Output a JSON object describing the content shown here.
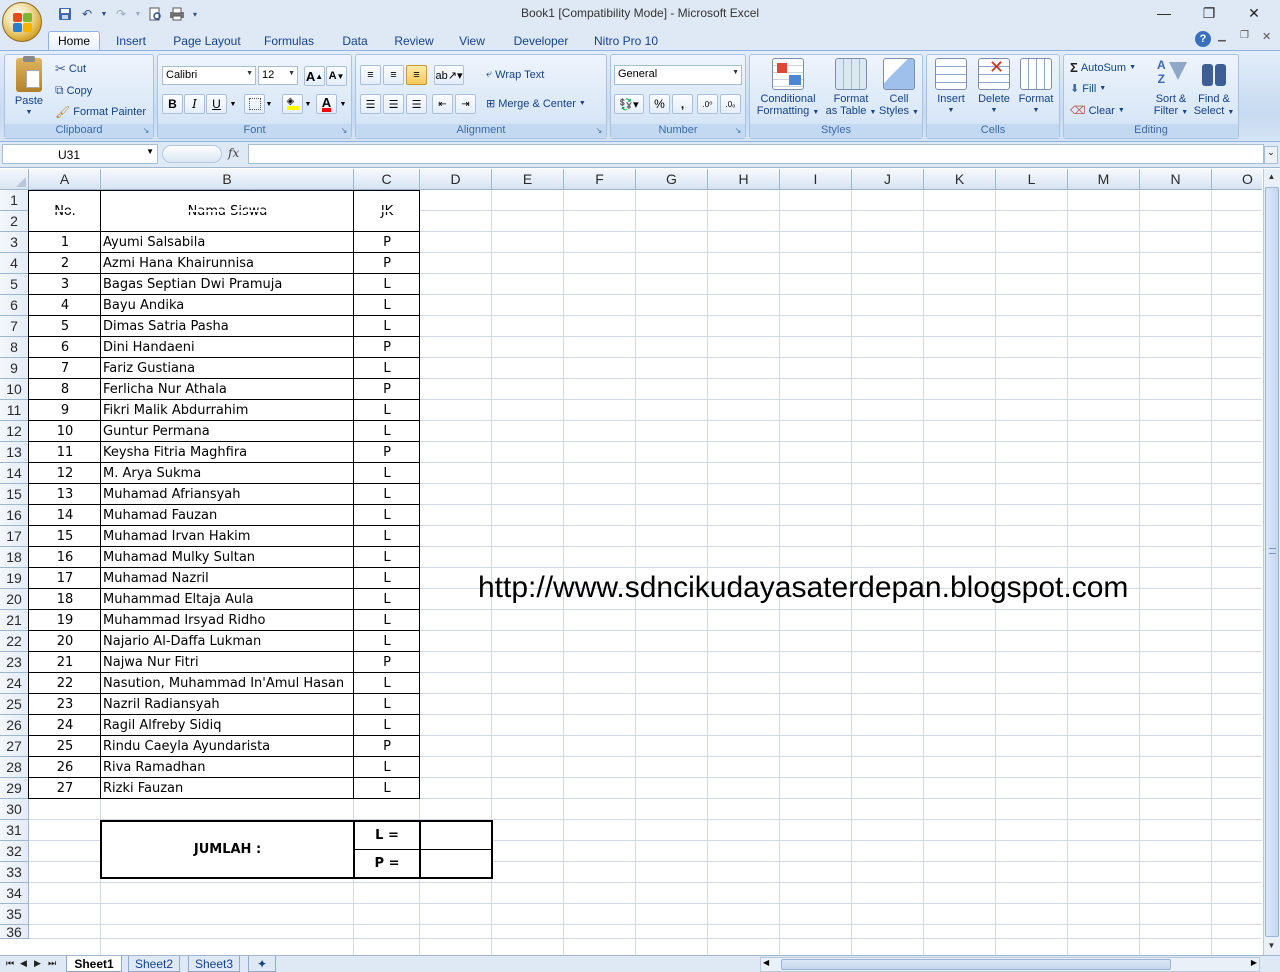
{
  "window": {
    "title": "Book1  [Compatibility Mode] - Microsoft Excel",
    "minimize": "—",
    "restore": "❐",
    "close": "✕"
  },
  "qat": {
    "save_icon": "save-icon",
    "undo_icon": "undo-icon",
    "redo_icon": "redo-icon"
  },
  "tabs": [
    "Home",
    "Insert",
    "Page Layout",
    "Formulas",
    "Data",
    "Review",
    "View",
    "Developer",
    "Nitro Pro 10"
  ],
  "ribbon": {
    "clipboard": {
      "label": "Clipboard",
      "paste": "Paste",
      "cut": "Cut",
      "copy": "Copy",
      "format_painter": "Format Painter"
    },
    "font": {
      "label": "Font",
      "family": "Calibri",
      "size": "12",
      "bold": "B",
      "italic": "I",
      "underline": "U"
    },
    "alignment": {
      "label": "Alignment",
      "wrap_text": "Wrap Text",
      "merge_center": "Merge & Center"
    },
    "number": {
      "label": "Number",
      "format": "General",
      "percent": "%",
      "comma": ",",
      "inc_decimal": ".0→.00",
      "dec_decimal": ".00→.0"
    },
    "styles": {
      "label": "Styles",
      "conditional": [
        "Conditional",
        "Formatting"
      ],
      "format_table": [
        "Format",
        "as Table"
      ],
      "cell_styles": [
        "Cell",
        "Styles"
      ]
    },
    "cells": {
      "label": "Cells",
      "insert": "Insert",
      "delete": "Delete",
      "format": "Format"
    },
    "editing": {
      "label": "Editing",
      "autosum": "AutoSum",
      "fill": "Fill",
      "clear": "Clear",
      "sort_filter": [
        "Sort &",
        "Filter"
      ],
      "find_select": [
        "Find &",
        "Select"
      ]
    }
  },
  "formula_bar": {
    "name_box": "U31",
    "fx": "fx",
    "content": ""
  },
  "columns": [
    "A",
    "B",
    "C",
    "D",
    "E",
    "F",
    "G",
    "H",
    "I",
    "J",
    "K",
    "L",
    "M",
    "N",
    "O"
  ],
  "rows": [
    "1",
    "2",
    "3",
    "4",
    "5",
    "6",
    "7",
    "8",
    "9",
    "10",
    "11",
    "12",
    "13",
    "14",
    "15",
    "16",
    "17",
    "18",
    "19",
    "20",
    "21",
    "22",
    "23",
    "24",
    "25",
    "26",
    "27",
    "28",
    "29",
    "30",
    "31",
    "32",
    "33",
    "34",
    "35",
    "36"
  ],
  "table": {
    "header_no": "No.",
    "header_name": "Nama Siswa",
    "header_jk": "JK",
    "students": [
      {
        "no": "1",
        "name": "Ayumi Salsabila",
        "jk": "P"
      },
      {
        "no": "2",
        "name": "Azmi Hana Khairunnisa",
        "jk": "P"
      },
      {
        "no": "3",
        "name": "Bagas Septian Dwi Pramuja",
        "jk": "L"
      },
      {
        "no": "4",
        "name": "Bayu Andika",
        "jk": "L"
      },
      {
        "no": "5",
        "name": "Dimas Satria Pasha",
        "jk": "L"
      },
      {
        "no": "6",
        "name": "Dini Handaeni",
        "jk": "P"
      },
      {
        "no": "7",
        "name": "Fariz Gustiana",
        "jk": "L"
      },
      {
        "no": "8",
        "name": "Ferlicha Nur Athala",
        "jk": "P"
      },
      {
        "no": "9",
        "name": "Fikri Malik Abdurrahim",
        "jk": "L"
      },
      {
        "no": "10",
        "name": "Guntur Permana",
        "jk": "L"
      },
      {
        "no": "11",
        "name": "Keysha Fitria Maghfira",
        "jk": "P"
      },
      {
        "no": "12",
        "name": "M. Arya Sukma",
        "jk": "L"
      },
      {
        "no": "13",
        "name": "Muhamad Afriansyah",
        "jk": "L"
      },
      {
        "no": "14",
        "name": "Muhamad Fauzan",
        "jk": "L"
      },
      {
        "no": "15",
        "name": "Muhamad Irvan Hakim",
        "jk": "L"
      },
      {
        "no": "16",
        "name": "Muhamad Mulky Sultan",
        "jk": "L"
      },
      {
        "no": "17",
        "name": "Muhamad Nazril",
        "jk": "L"
      },
      {
        "no": "18",
        "name": "Muhammad Eltaja Aula",
        "jk": "L"
      },
      {
        "no": "19",
        "name": "Muhammad Irsyad Ridho",
        "jk": "L"
      },
      {
        "no": "20",
        "name": "Najario Al-Daffa Lukman",
        "jk": "L"
      },
      {
        "no": "21",
        "name": "Najwa Nur Fitri",
        "jk": "P"
      },
      {
        "no": "22",
        "name": "Nasution, Muhammad In'Amul Hasan",
        "jk": "L"
      },
      {
        "no": "23",
        "name": "Nazril Radiansyah",
        "jk": "L"
      },
      {
        "no": "24",
        "name": "Ragil Alfreby Sidiq",
        "jk": "L"
      },
      {
        "no": "25",
        "name": "Rindu Caeyla Ayundarista",
        "jk": "P"
      },
      {
        "no": "26",
        "name": "Riva Ramadhan",
        "jk": "L"
      },
      {
        "no": "27",
        "name": "Rizki Fauzan",
        "jk": "L"
      }
    ],
    "jumlah_label": "JUMLAH  :",
    "l_label": "L  =",
    "p_label": "P  ="
  },
  "watermark": "http://www.sdncikudayasaterdepan.blogspot.com",
  "sheets": [
    "Sheet1",
    "Sheet2",
    "Sheet3"
  ],
  "active_sheet": "Sheet1"
}
